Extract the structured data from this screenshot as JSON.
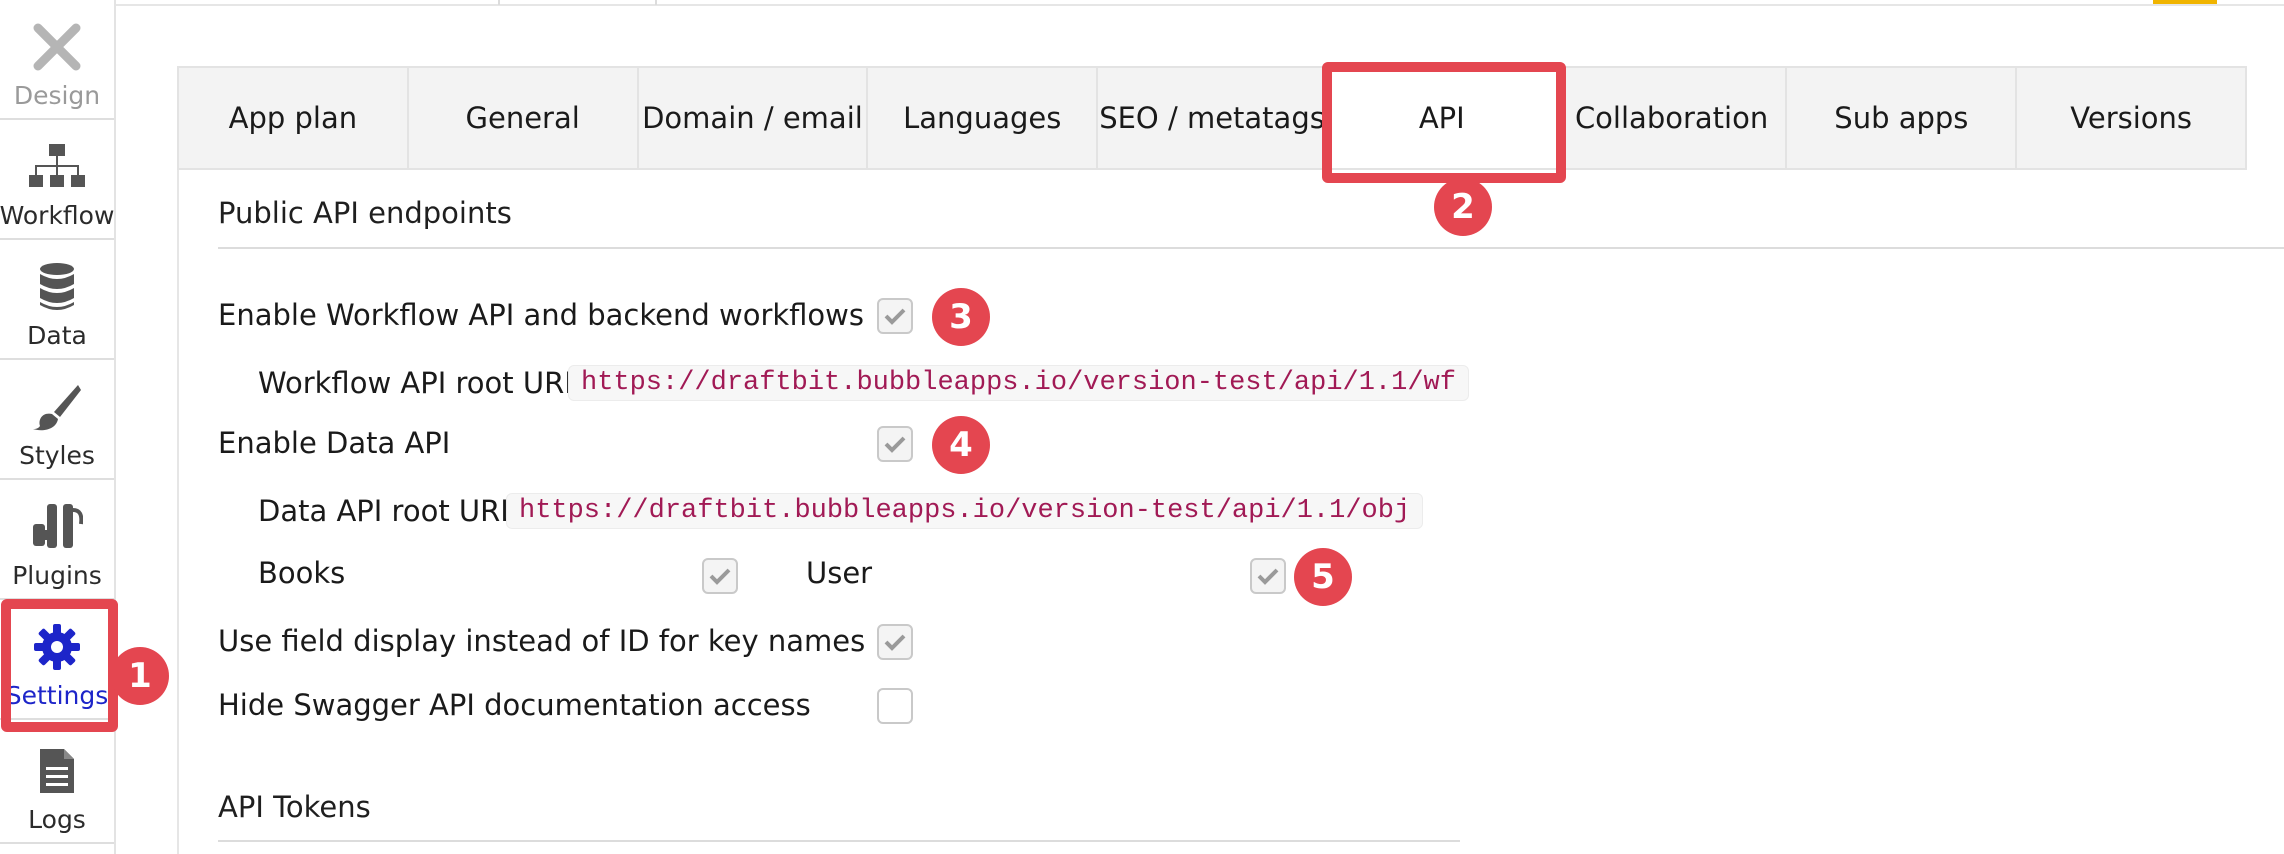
{
  "sidebar": {
    "items": [
      {
        "label": "Design",
        "icon": "design-icon"
      },
      {
        "label": "Workflow",
        "icon": "workflow-icon"
      },
      {
        "label": "Data",
        "icon": "database-icon"
      },
      {
        "label": "Styles",
        "icon": "brush-icon"
      },
      {
        "label": "Plugins",
        "icon": "plug-icon"
      },
      {
        "label": "Settings",
        "icon": "gear-icon"
      },
      {
        "label": "Logs",
        "icon": "document-icon"
      }
    ]
  },
  "tabs": [
    {
      "label": "App plan"
    },
    {
      "label": "General"
    },
    {
      "label": "Domain / email"
    },
    {
      "label": "Languages"
    },
    {
      "label": "SEO / metatags"
    },
    {
      "label": "API"
    },
    {
      "label": "Collaboration"
    },
    {
      "label": "Sub apps"
    },
    {
      "label": "Versions"
    }
  ],
  "api": {
    "public_endpoints_title": "Public API endpoints",
    "workflow_api_label": "Enable Workflow API and backend workflows",
    "workflow_api_checked": true,
    "workflow_root_label": "Workflow API root URL:",
    "workflow_root_url": "https://draftbit.bubbleapps.io/version-test/api/1.1/wf",
    "data_api_label": "Enable Data API",
    "data_api_checked": true,
    "data_root_label": "Data API root URL:",
    "data_root_url": "https://draftbit.bubbleapps.io/version-test/api/1.1/obj",
    "types": [
      {
        "label": "Books",
        "checked": true
      },
      {
        "label": "User",
        "checked": true
      }
    ],
    "field_display_label": "Use field display instead of ID for key names",
    "field_display_checked": true,
    "hide_swagger_label": "Hide Swagger API documentation access",
    "hide_swagger_checked": false,
    "tokens_title": "API Tokens"
  },
  "callouts": [
    "1",
    "2",
    "3",
    "4",
    "5"
  ],
  "colors": {
    "callout_red": "#e44650",
    "active_blue": "#1d25c9",
    "url_text": "#a11a55",
    "top_accent": "#f0b400"
  }
}
